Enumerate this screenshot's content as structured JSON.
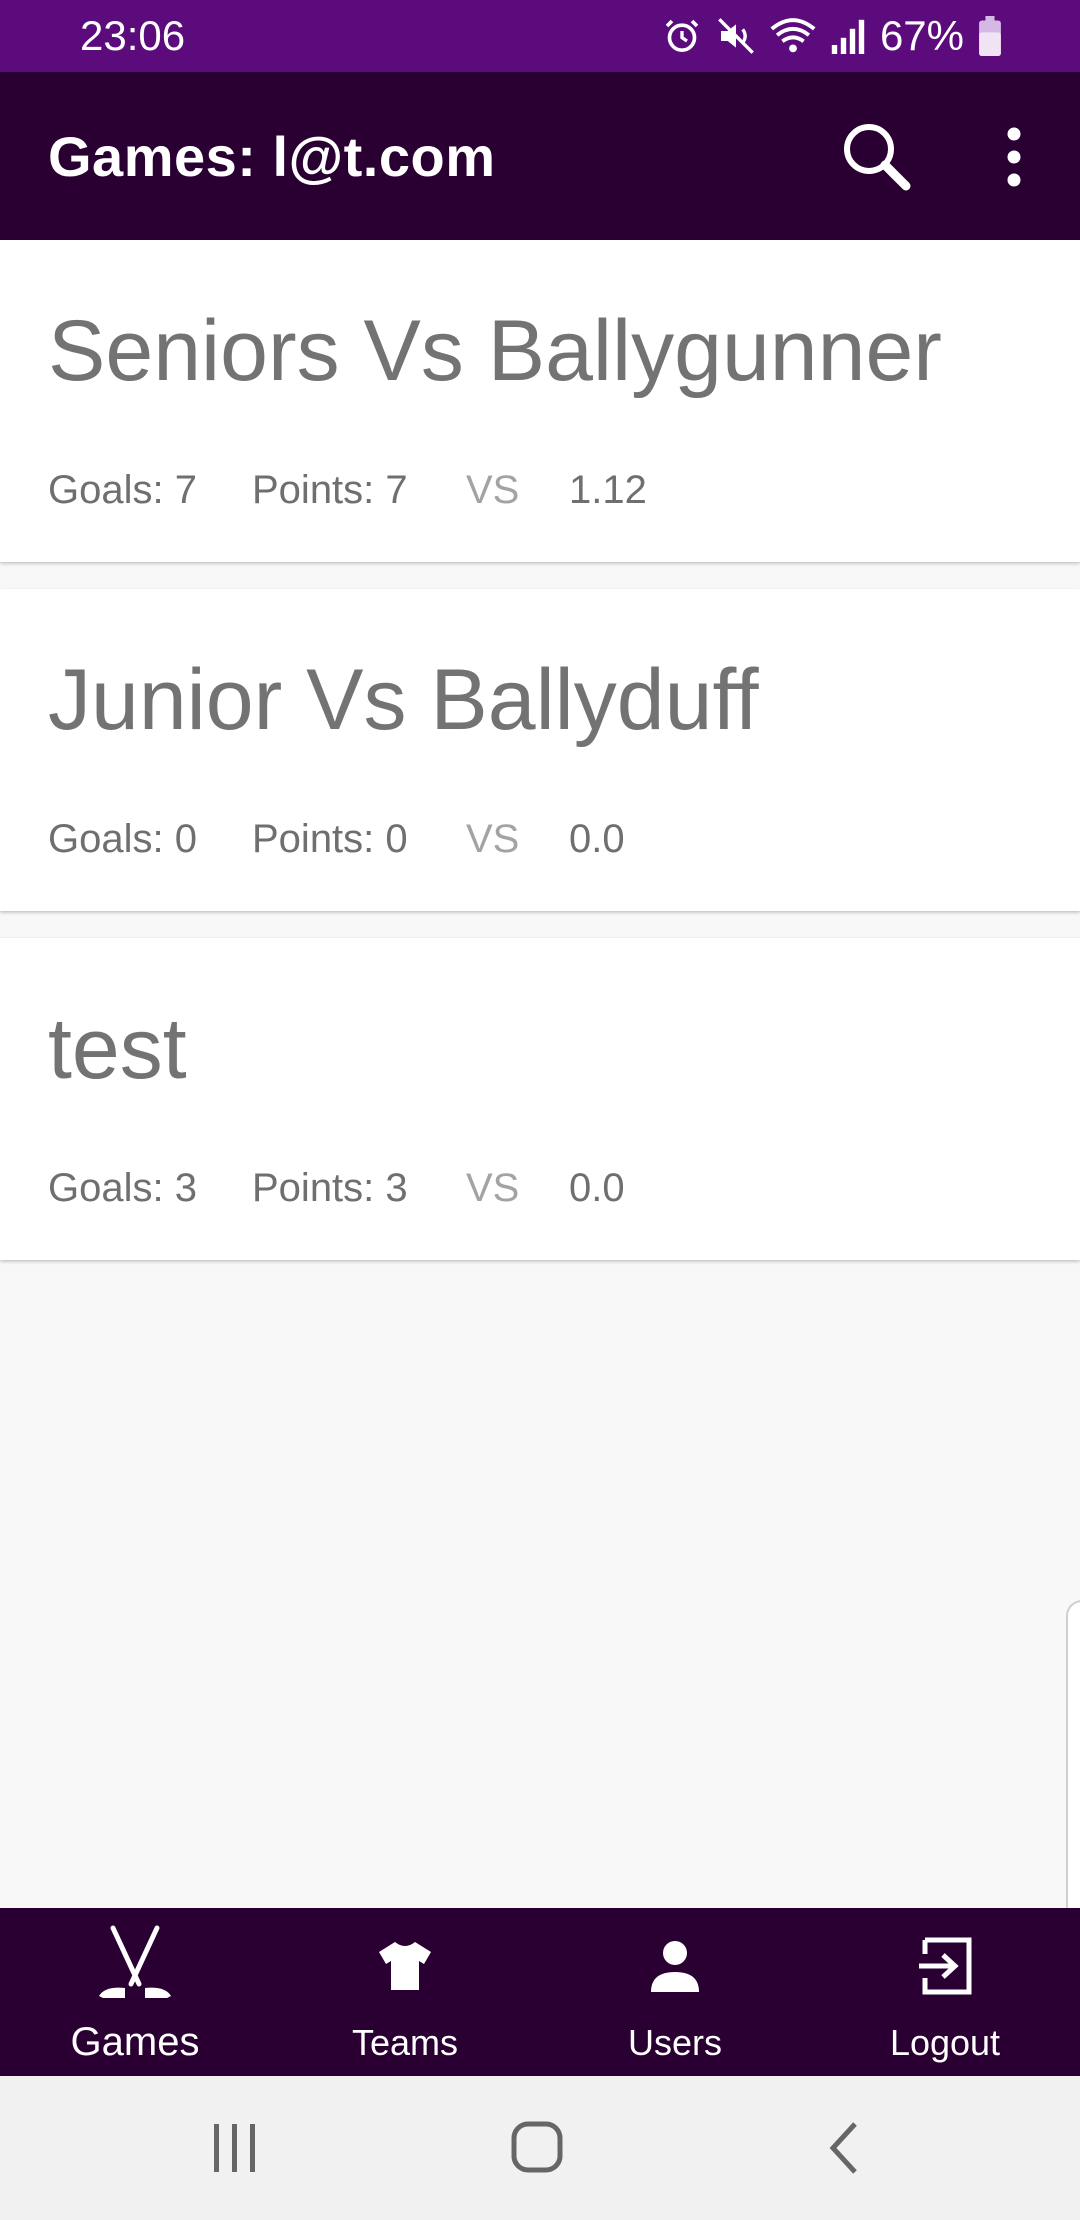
{
  "status_bar": {
    "time": "23:06",
    "battery": "67%",
    "icons": [
      "alarm-icon",
      "mute-icon",
      "wifi-icon",
      "signal-icon",
      "battery-icon"
    ]
  },
  "app_bar": {
    "title": "Games: l@t.com",
    "actions": [
      "search-icon",
      "more-vert-icon"
    ]
  },
  "games": [
    {
      "title": "Seniors Vs Ballygunner",
      "goals": "Goals: 7",
      "points": "Points: 7",
      "vs": "VS",
      "score": "1.12"
    },
    {
      "title": "Junior Vs Ballyduff",
      "goals": "Goals: 0",
      "points": "Points: 0",
      "vs": "VS",
      "score": "0.0"
    },
    {
      "title": "test",
      "goals": "Goals: 3",
      "points": "Points: 3",
      "vs": "VS",
      "score": "0.0"
    }
  ],
  "bottom_nav": {
    "items": [
      {
        "label": "Games",
        "icon": "hockey-sticks-icon",
        "active": true
      },
      {
        "label": "Teams",
        "icon": "shirt-icon",
        "active": false
      },
      {
        "label": "Users",
        "icon": "person-icon",
        "active": false
      },
      {
        "label": "Logout",
        "icon": "logout-icon",
        "active": false
      }
    ]
  },
  "system_nav": [
    "recents-icon",
    "home-icon",
    "back-icon"
  ],
  "colors": {
    "status_bar": "#5c0b7d",
    "app_bar": "#2a0033",
    "text_gray": "#737373",
    "background": "#f8f8f8"
  }
}
